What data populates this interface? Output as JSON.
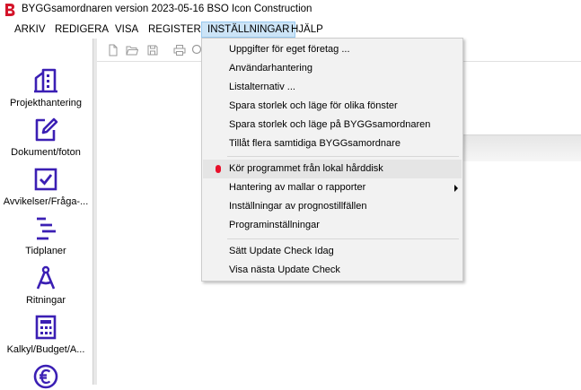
{
  "window": {
    "title": "BYGGsamordnaren version 2023-05-16   BSO Icon Construction"
  },
  "menubar": {
    "items": [
      "ARKIV",
      "REDIGERA",
      "VISA",
      "REGISTER",
      "INSTÄLLNINGAR",
      "HJÄLP"
    ],
    "active": "INSTÄLLNINGAR"
  },
  "sidebar": {
    "items": [
      {
        "label": "Projekthantering",
        "icon": "building-icon"
      },
      {
        "label": "Dokument/foton",
        "icon": "document-edit-icon"
      },
      {
        "label": "Avvikelser/Fråga-...",
        "icon": "checkbox-icon"
      },
      {
        "label": "Tidplaner",
        "icon": "gantt-icon"
      },
      {
        "label": "Ritningar",
        "icon": "compass-icon"
      },
      {
        "label": "Kalkyl/Budget/A...",
        "icon": "calculator-icon"
      },
      {
        "label": "",
        "icon": "euro-icon"
      }
    ]
  },
  "toolbar": {
    "icons": [
      "new-file-icon",
      "open-folder-icon",
      "save-icon",
      "print-icon",
      "search-icon"
    ]
  },
  "dropdown": {
    "groups": [
      {
        "items": [
          {
            "label": "Uppgifter för eget företag ..."
          },
          {
            "label": "Användarhantering"
          },
          {
            "label": "Listalternativ ..."
          },
          {
            "label": "Spara storlek och läge för olika fönster"
          },
          {
            "label": "Spara storlek och läge på BYGGsamordnaren"
          },
          {
            "label": "Tillåt flera samtidiga BYGGsamordnare"
          }
        ]
      },
      {
        "items": [
          {
            "label": "Kör programmet från lokal hårddisk",
            "marker": "red-dot"
          },
          {
            "label": "Hantering av mallar o rapporter",
            "submenu": true
          },
          {
            "label": "Inställningar av prognostillfällen"
          },
          {
            "label": "Programinställningar"
          }
        ]
      },
      {
        "items": [
          {
            "label": "Sätt Update Check Idag"
          },
          {
            "label": "Visa nästa Update Check"
          }
        ]
      }
    ]
  },
  "colors": {
    "accent": "#3b1fb4",
    "menu_active_bg": "#cce4f7",
    "red_marker": "#e8102a"
  }
}
